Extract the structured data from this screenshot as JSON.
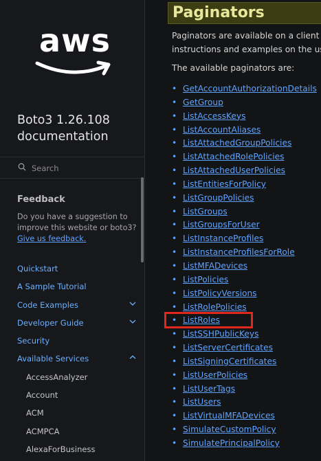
{
  "sidebar": {
    "logo_text": "aws",
    "title": "Boto3 1.26.108 documentation",
    "search": {
      "placeholder": "Search"
    },
    "feedback": {
      "heading": "Feedback",
      "text": "Do you have a suggestion to improve this website or boto3?",
      "link": "Give us feedback."
    },
    "nav": [
      {
        "label": "Quickstart",
        "chevron": ""
      },
      {
        "label": "A Sample Tutorial",
        "chevron": ""
      },
      {
        "label": "Code Examples",
        "chevron": "down"
      },
      {
        "label": "Developer Guide",
        "chevron": "down"
      },
      {
        "label": "Security",
        "chevron": ""
      },
      {
        "label": "Available Services",
        "chevron": "up"
      }
    ],
    "services": [
      "AccessAnalyzer",
      "Account",
      "ACM",
      "ACMPCA",
      "AlexaForBusiness"
    ]
  },
  "content": {
    "heading": "Paginators",
    "intro_line1": "Paginators are available on a client in",
    "intro_line2": "instructions and examples on the usa",
    "available": "The available paginators are:",
    "paginators": [
      "GetAccountAuthorizationDetails",
      "GetGroup",
      "ListAccessKeys",
      "ListAccountAliases",
      "ListAttachedGroupPolicies",
      "ListAttachedRolePolicies",
      "ListAttachedUserPolicies",
      "ListEntitiesForPolicy",
      "ListGroupPolicies",
      "ListGroups",
      "ListGroupsForUser",
      "ListInstanceProfiles",
      "ListInstanceProfilesForRole",
      "ListMFADevices",
      "ListPolicies",
      "ListPolicyVersions",
      "ListRolePolicies",
      "ListRoles",
      "ListSSHPublicKeys",
      "ListServerCertificates",
      "ListSigningCertificates",
      "ListUserPolicies",
      "ListUserTags",
      "ListUsers",
      "ListVirtualMFADevices",
      "SimulateCustomPolicy",
      "SimulatePrincipalPolicy"
    ],
    "highlighted": "ListRoles",
    "colors": {
      "link": "#5fa3ff",
      "highlight": "#e0281c",
      "heading_bg": "#3d3d14"
    }
  }
}
